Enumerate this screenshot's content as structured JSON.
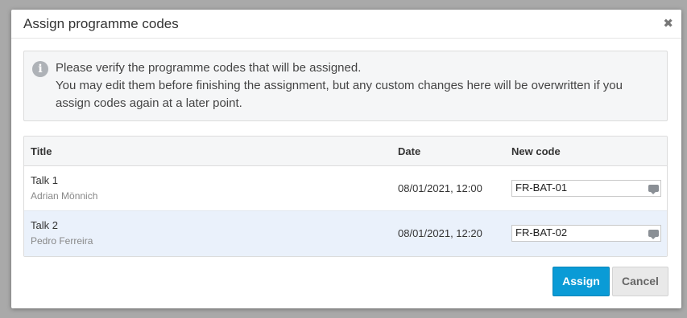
{
  "dialog": {
    "title": "Assign programme codes",
    "close_glyph": "✖"
  },
  "info": {
    "icon": "info-icon",
    "line1": "Please verify the programme codes that will be assigned.",
    "line2": "You may edit them before finishing the assignment, but any custom changes here will be overwritten if you assign codes again at a later point."
  },
  "table": {
    "headers": {
      "title": "Title",
      "date": "Date",
      "new_code": "New code"
    },
    "rows": [
      {
        "talk": "Talk 1",
        "speaker": "Adrian Mönnich",
        "date": "08/01/2021, 12:00",
        "code": "FR-BAT-01"
      },
      {
        "talk": "Talk 2",
        "speaker": "Pedro Ferreira",
        "date": "08/01/2021, 12:20",
        "code": "FR-BAT-02"
      }
    ]
  },
  "buttons": {
    "assign": "Assign",
    "cancel": "Cancel"
  },
  "colors": {
    "primary": "#0a9bd6",
    "row_highlight": "#eaf1fb"
  }
}
